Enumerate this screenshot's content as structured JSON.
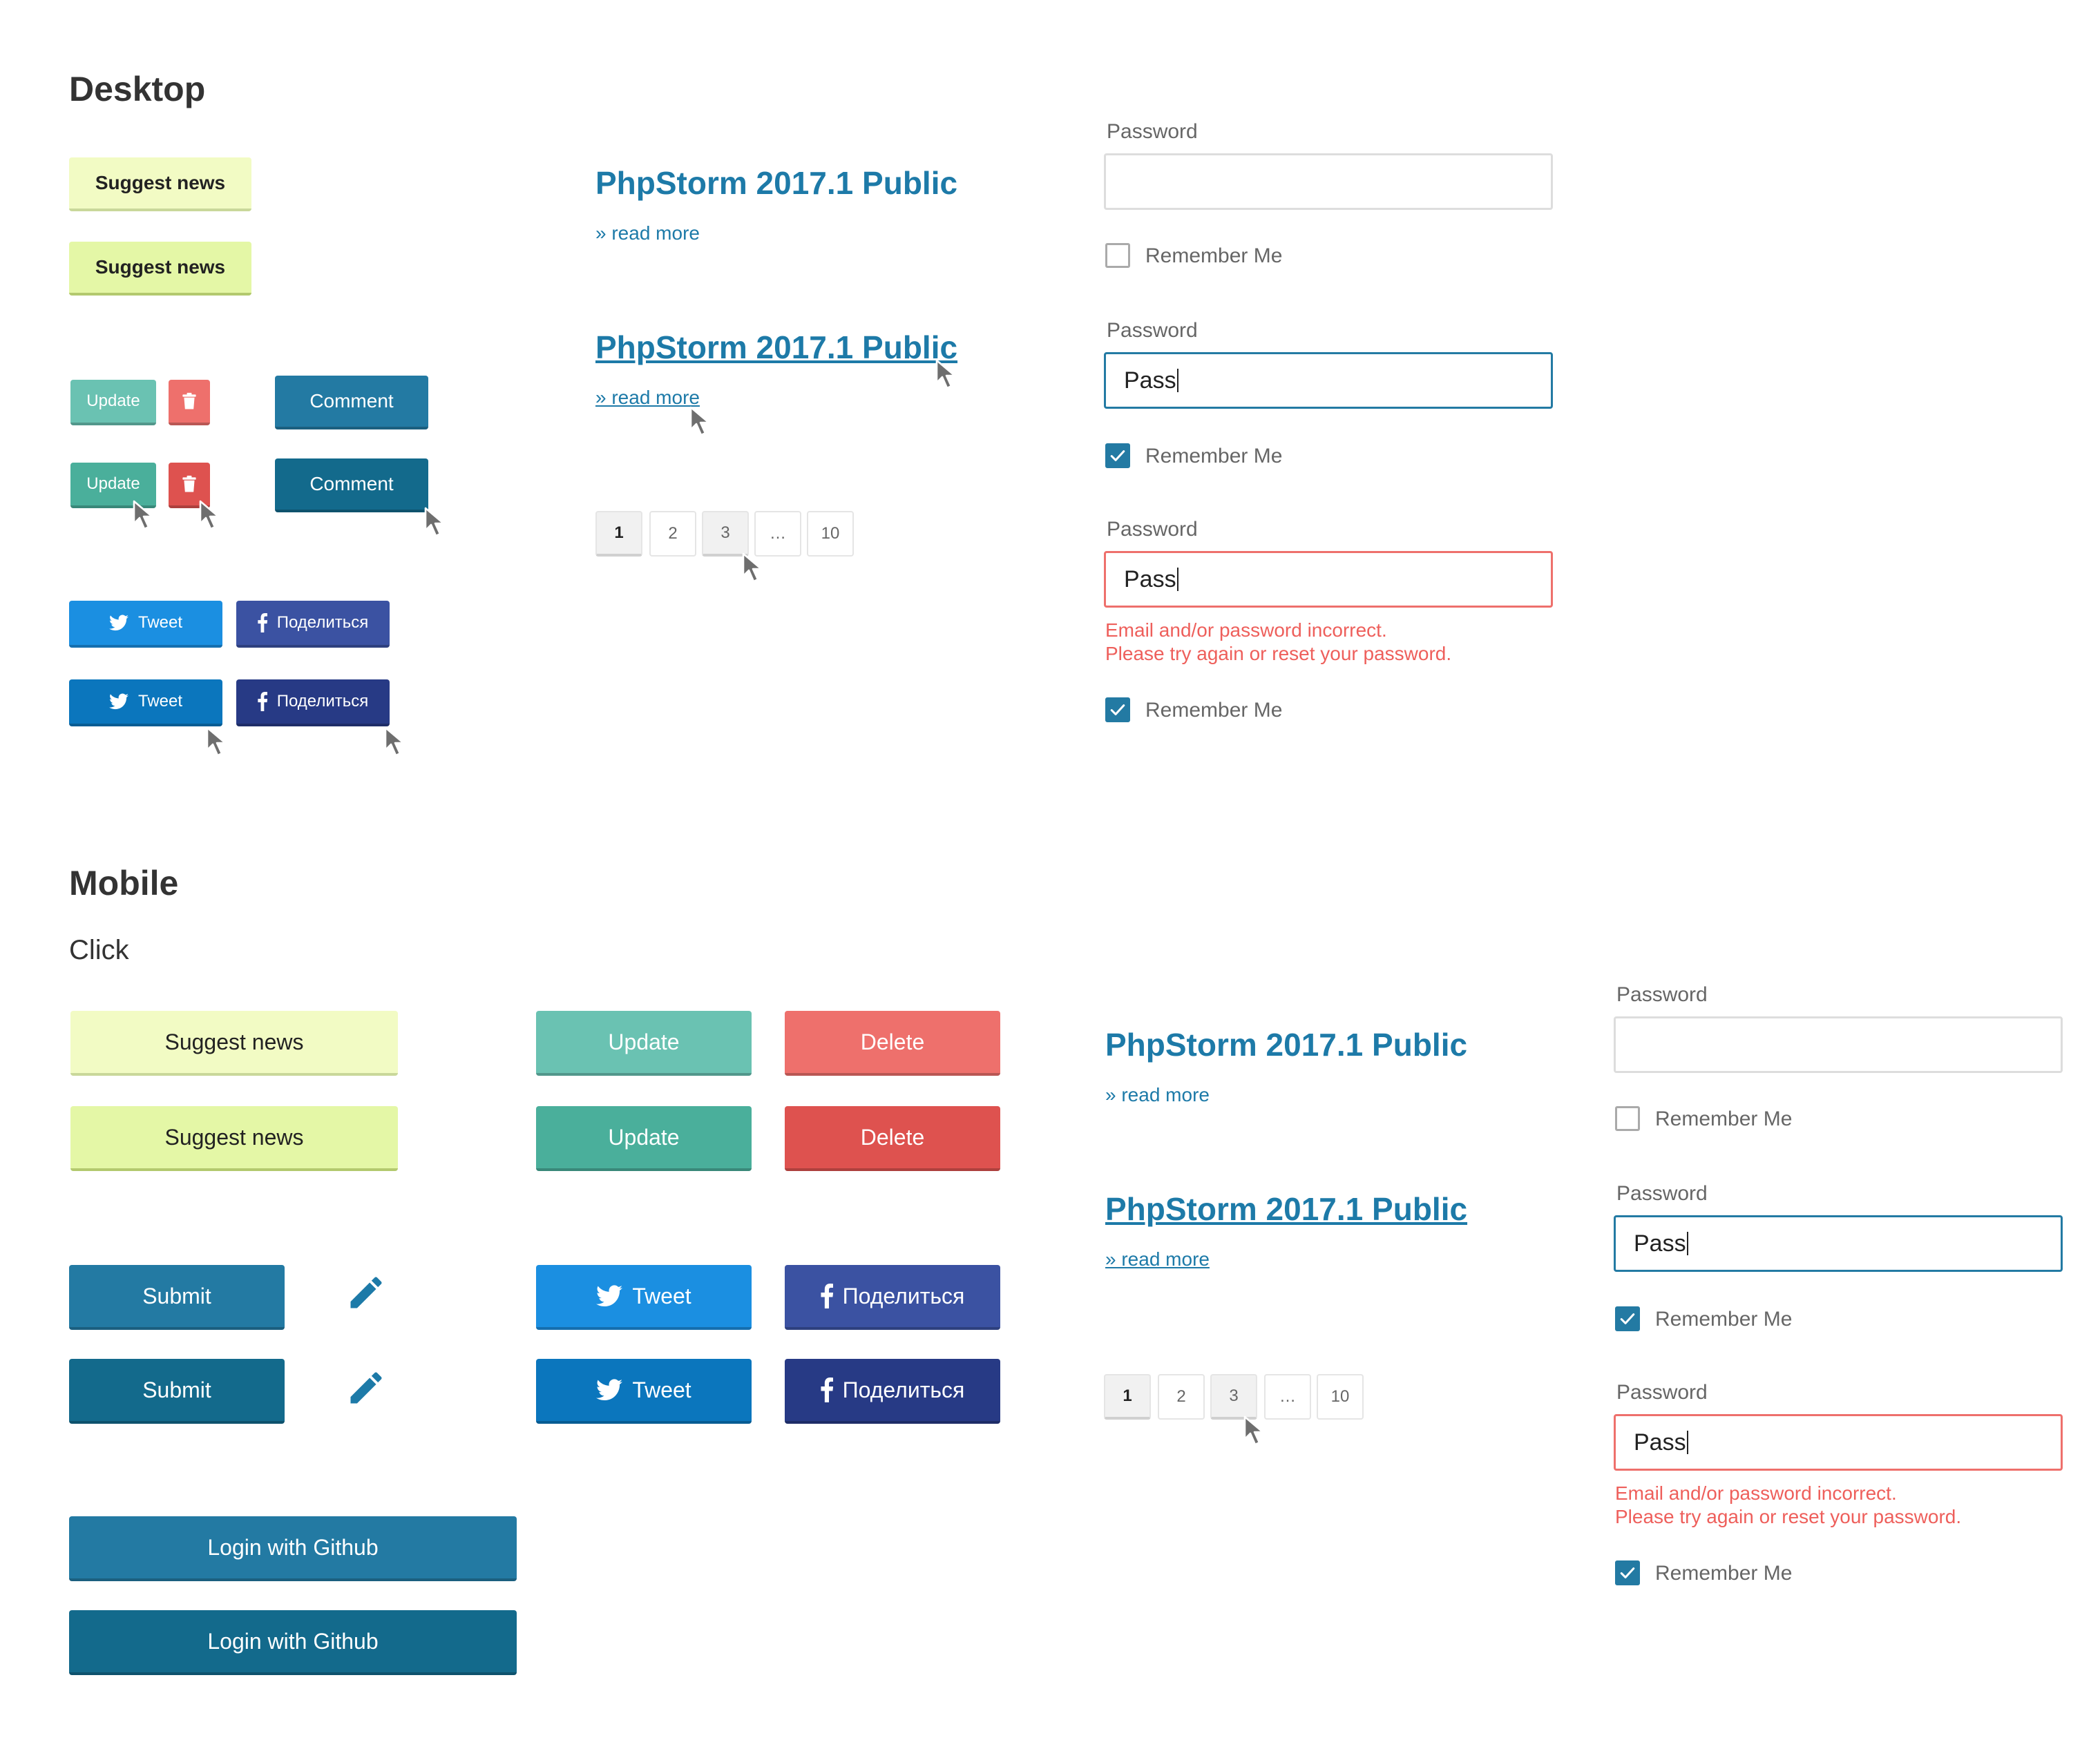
{
  "desktop": {
    "heading": "Desktop",
    "suggest": [
      "Suggest news",
      "Suggest news"
    ],
    "update": [
      "Update",
      "Update"
    ],
    "comment": [
      "Comment",
      "Comment"
    ],
    "tweet": [
      "Tweet",
      "Tweet"
    ],
    "share": [
      "Поделиться",
      "Поделиться"
    ],
    "article": {
      "title": "PhpStorm 2017.1 Public",
      "read_more": "» read more"
    },
    "pagination": [
      "1",
      "2",
      "3",
      "…",
      "10"
    ],
    "form": {
      "password_label": "Password",
      "value": "Pass",
      "remember": "Remember Me",
      "error_line1": "Email and/or password incorrect.",
      "error_line2": "Please try again or reset your password."
    }
  },
  "mobile": {
    "heading": "Mobile",
    "subheading": "Click",
    "suggest": [
      "Suggest news",
      "Suggest news"
    ],
    "update": [
      "Update",
      "Update"
    ],
    "delete": [
      "Delete",
      "Delete"
    ],
    "submit": [
      "Submit",
      "Submit"
    ],
    "tweet": [
      "Tweet",
      "Tweet"
    ],
    "share": [
      "Поделиться",
      "Поделиться"
    ],
    "github": [
      "Login with Github",
      "Login with Github"
    ],
    "article": {
      "title": "PhpStorm 2017.1 Public",
      "read_more": "» read more"
    },
    "pagination": [
      "1",
      "2",
      "3",
      "…",
      "10"
    ],
    "form": {
      "password_label": "Password",
      "value": "Pass",
      "remember": "Remember Me",
      "error_line1": "Email and/or password incorrect.",
      "error_line2": "Please try again or reset your password."
    }
  },
  "colors": {
    "link": "#1d7aa8",
    "primary": "#237aa3",
    "primary_active": "#136a8c",
    "danger": "#ee706c",
    "twitter": "#1b8fe1",
    "facebook": "#3b52a2",
    "teal": "#6ac2b2",
    "lime": "#f2fbc4"
  },
  "icons": [
    "trash-icon",
    "twitter-icon",
    "facebook-icon",
    "pencil-icon",
    "check-icon",
    "cursor-icon"
  ]
}
